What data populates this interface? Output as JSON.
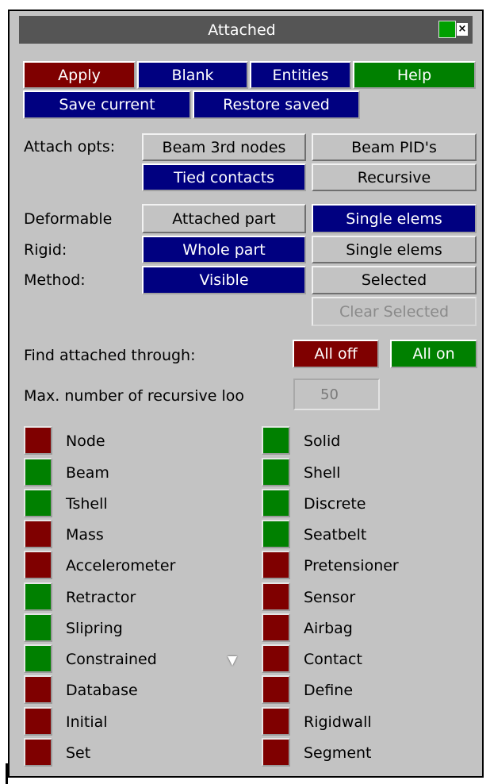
{
  "window": {
    "title": "Attached"
  },
  "actions": {
    "apply": "Apply",
    "blank": "Blank",
    "entities": "Entities",
    "help": "Help",
    "save_current": "Save current",
    "restore_saved": "Restore saved"
  },
  "attach_opts": {
    "label": "Attach opts:",
    "beam_3rd_nodes": "Beam 3rd nodes",
    "beam_pids": "Beam PID's",
    "tied_contacts": "Tied contacts",
    "recursive": "Recursive"
  },
  "deformable": {
    "label": "Deformable",
    "attached_part": "Attached part",
    "single_elems": "Single elems"
  },
  "rigid": {
    "label": "Rigid:",
    "whole_part": "Whole part",
    "single_elems": "Single elems"
  },
  "method": {
    "label": "Method:",
    "visible": "Visible",
    "selected": "Selected",
    "clear_selected": "Clear Selected"
  },
  "find_attached": {
    "label": "Find attached through:",
    "all_off": "All off",
    "all_on": "All on"
  },
  "max_recursive": {
    "label": "Max. number of recursive loo",
    "value": "50"
  },
  "colors": {
    "on": "#008000",
    "off": "#7f0000",
    "active": "#000080"
  },
  "entity_toggles": {
    "left": [
      {
        "label": "Node",
        "on": false
      },
      {
        "label": "Beam",
        "on": true
      },
      {
        "label": "Tshell",
        "on": true
      },
      {
        "label": "Mass",
        "on": false
      },
      {
        "label": "Accelerometer",
        "on": false
      },
      {
        "label": "Retractor",
        "on": true
      },
      {
        "label": "Slipring",
        "on": true
      },
      {
        "label": "Constrained",
        "on": true
      },
      {
        "label": "Database",
        "on": false
      },
      {
        "label": "Initial",
        "on": false
      },
      {
        "label": "Set",
        "on": false
      }
    ],
    "right": [
      {
        "label": "Solid",
        "on": true
      },
      {
        "label": "Shell",
        "on": true
      },
      {
        "label": "Discrete",
        "on": true
      },
      {
        "label": "Seatbelt",
        "on": true
      },
      {
        "label": "Pretensioner",
        "on": false
      },
      {
        "label": "Sensor",
        "on": false
      },
      {
        "label": "Airbag",
        "on": false
      },
      {
        "label": "Contact",
        "on": false
      },
      {
        "label": "Define",
        "on": false
      },
      {
        "label": "Rigidwall",
        "on": false
      },
      {
        "label": "Segment",
        "on": false
      }
    ]
  }
}
